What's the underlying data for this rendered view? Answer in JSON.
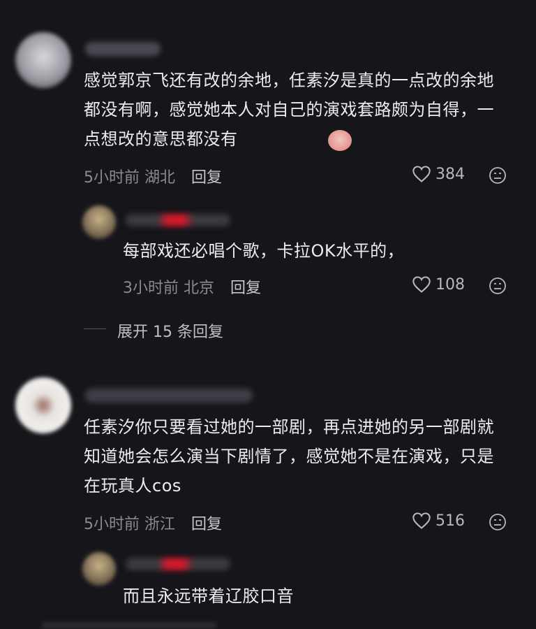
{
  "comments": [
    {
      "text": "感觉郭京飞还有改的余地，任素汐是真的一点改的余地都没有啊，感觉她本人对自己的演戏套路颇为自得，一点想改的意思都没有",
      "time": "5小时前",
      "location": "湖北",
      "reply_label": "回复",
      "likes": "384",
      "reply": {
        "text": "每部戏还必唱个歌，卡拉OK水平的，",
        "time": "3小时前",
        "location": "北京",
        "reply_label": "回复",
        "likes": "108"
      },
      "expand_label": "展开 15 条回复"
    },
    {
      "text": "任素汐你只要看过她的一部剧，再点进她的另一部剧就知道她会怎么演当下剧情了，感觉她不是在演戏，只是在玩真人cos",
      "time": "5小时前",
      "location": "浙江",
      "reply_label": "回复",
      "likes": "516",
      "reply": {
        "text": "而且永远带着辽胶口音"
      }
    }
  ],
  "colors": {
    "background": "#16151a",
    "text": "#ececee",
    "meta": "#8a8a90",
    "heart": "#b8b8bc",
    "name_blur_red": "#d11a2a"
  }
}
